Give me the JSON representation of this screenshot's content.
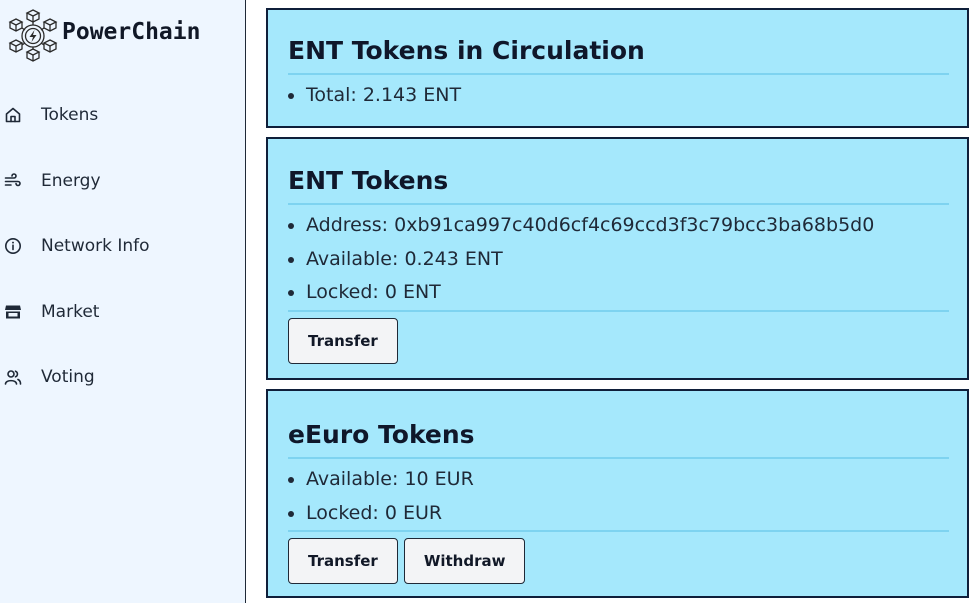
{
  "brand": {
    "name": "PowerChain"
  },
  "sidebar": {
    "items": [
      {
        "label": "Tokens",
        "icon": "home-icon"
      },
      {
        "label": "Energy",
        "icon": "wind-icon"
      },
      {
        "label": "Network Info",
        "icon": "info-icon"
      },
      {
        "label": "Market",
        "icon": "store-icon"
      },
      {
        "label": "Voting",
        "icon": "users-icon"
      }
    ]
  },
  "circulation": {
    "title": "ENT Tokens in Circulation",
    "total": "Total: 2.143 ENT"
  },
  "ent": {
    "title": "ENT Tokens",
    "address": "Address: 0xb91ca997c40d6cf4c69ccd3f3c79bcc3ba68b5d0",
    "available": "Available: 0.243 ENT",
    "locked": "Locked: 0 ENT",
    "transfer_label": "Transfer"
  },
  "eeuro": {
    "title": "eEuro Tokens",
    "available": "Available: 10 EUR",
    "locked": "Locked: 0 EUR",
    "transfer_label": "Transfer",
    "withdraw_label": "Withdraw"
  },
  "colors": {
    "card_bg": "#a5e8fc",
    "card_border": "#0f1f3a",
    "sidebar_bg": "#eef6ff"
  }
}
